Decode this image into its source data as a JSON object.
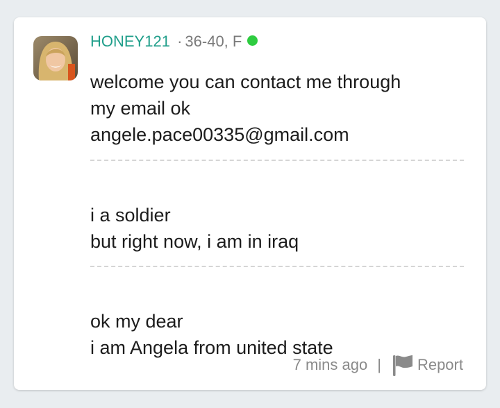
{
  "post": {
    "username": "HONEY121",
    "separator": "·",
    "meta": "36-40, F",
    "online_status_color": "#2ecc40",
    "avatar_icon": "user-photo-avatar",
    "messages": [
      "welcome you can contact me through\nmy email ok\nangele.pace00335@gmail.com",
      "i a soldier\nbut right now, i am in iraq",
      "ok my dear\ni am Angela from united state"
    ],
    "timestamp": "7 mins ago",
    "divider": "|",
    "report_label": "Report",
    "report_icon": "flag-icon"
  },
  "colors": {
    "background": "#e9edf0",
    "card": "#ffffff",
    "username": "#1f9e8a",
    "text": "#1c1c1c",
    "muted": "#8a8a8a"
  }
}
